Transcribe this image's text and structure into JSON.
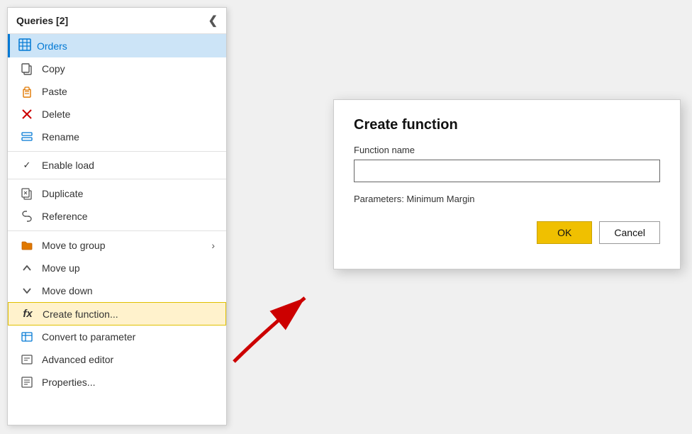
{
  "panel": {
    "title": "Queries [2]",
    "collapse_icon": "❮",
    "orders_label": "Orders"
  },
  "menu_items": [
    {
      "id": "copy",
      "label": "Copy",
      "icon": "copy"
    },
    {
      "id": "paste",
      "label": "Paste",
      "icon": "paste"
    },
    {
      "id": "delete",
      "label": "Delete",
      "icon": "delete"
    },
    {
      "id": "rename",
      "label": "Rename",
      "icon": "rename"
    },
    {
      "id": "enable-load",
      "label": "Enable load",
      "icon": "check",
      "has_check": true
    },
    {
      "id": "duplicate",
      "label": "Duplicate",
      "icon": "duplicate"
    },
    {
      "id": "reference",
      "label": "Reference",
      "icon": "reference"
    },
    {
      "id": "move-to-group",
      "label": "Move to group",
      "icon": "folder",
      "has_arrow": true
    },
    {
      "id": "move-up",
      "label": "Move up",
      "icon": "move-up"
    },
    {
      "id": "move-down",
      "label": "Move down",
      "icon": "move-down"
    },
    {
      "id": "create-function",
      "label": "Create function...",
      "icon": "fx",
      "highlighted": true
    },
    {
      "id": "convert-to-param",
      "label": "Convert to parameter",
      "icon": "convert"
    },
    {
      "id": "advanced-editor",
      "label": "Advanced editor",
      "icon": "advanced"
    },
    {
      "id": "properties",
      "label": "Properties...",
      "icon": "properties"
    }
  ],
  "dialog": {
    "title": "Create function",
    "function_name_label": "Function name",
    "function_name_placeholder": "",
    "params_label": "Parameters: Minimum Margin",
    "ok_label": "OK",
    "cancel_label": "Cancel"
  }
}
